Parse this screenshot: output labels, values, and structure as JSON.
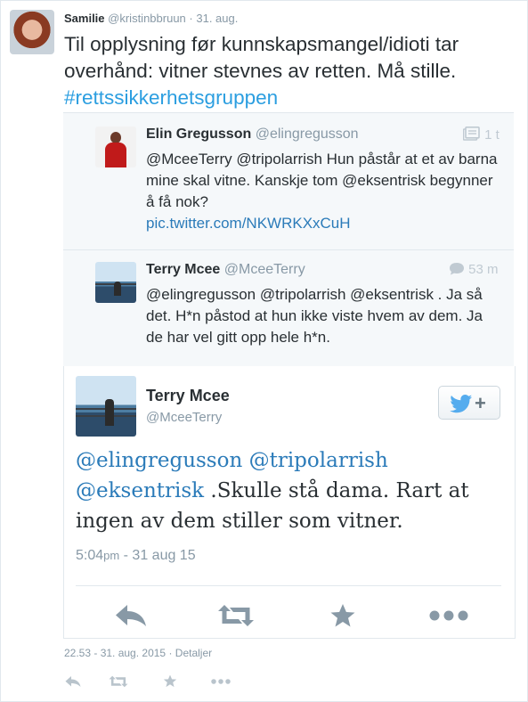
{
  "tweet": {
    "author_name": "Samilie",
    "author_handle": "@kristinbbruun",
    "separator": "·",
    "date": "31. aug.",
    "text": "Til opplysning før kunnskapsmangel/idioti tar overhånd: vitner stevnes av retten. Må stille.",
    "hashtag": "#rettssikkerhetsgruppen"
  },
  "nested": [
    {
      "name": "Elin Gregusson",
      "handle": "@elingregusson",
      "time": "1 t",
      "text": "@MceeTerry @tripolarrish Hun påstår at et av barna mine skal vitne. Kanskje tom @eksentrisk begynner å få nok?",
      "link": "pic.twitter.com/NKWRKXxCuH"
    },
    {
      "name": "Terry Mcee",
      "handle": "@MceeTerry",
      "time": "53 m",
      "text": "@elingregusson @tripolarrish @eksentrisk . Ja så det. H*n påstod at hun ikke viste hvem av dem. Ja de har vel gitt opp hele h*n."
    }
  ],
  "focused": {
    "name": "Terry Mcee",
    "handle": "@MceeTerry",
    "mentions": [
      "@elingregusson",
      "@tripolarrish",
      "@eksentrisk"
    ],
    "text": " .Skulle stå dama. Rart at ingen av dem stiller som vitner.",
    "time": "5:04",
    "ampm": "pm",
    "date": " - 31 aug 15",
    "follow_plus": "+"
  },
  "footer": {
    "timestamp": "22.53 - 31. aug. 2015",
    "separator": "·",
    "details": "Detaljer"
  },
  "icons": [
    "reply-icon",
    "retweet-icon",
    "favorite-icon",
    "more-icon",
    "twitter-bird-icon",
    "comment-icon",
    "gallery-icon"
  ],
  "colors": {
    "link": "#2b7bb9",
    "hashtag": "#2b9ee0",
    "muted": "#8899a6",
    "bird": "#55acee"
  }
}
